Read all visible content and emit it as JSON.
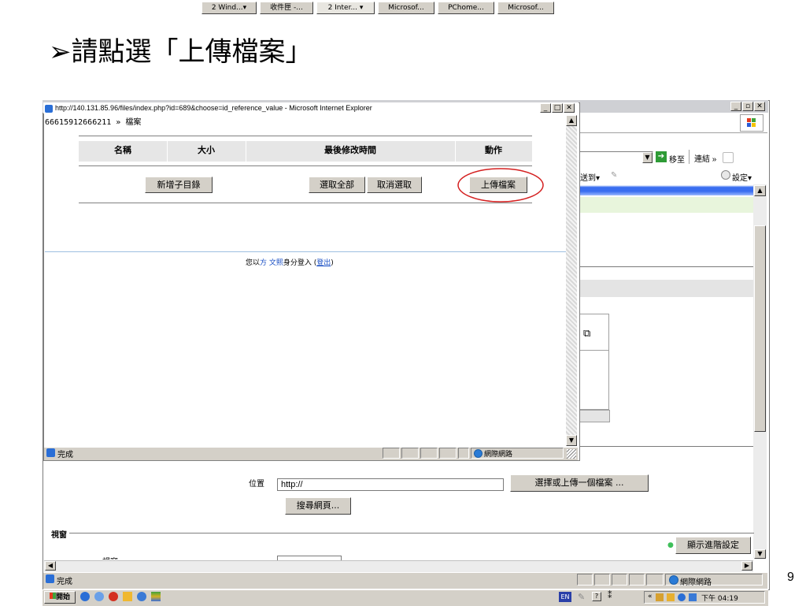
{
  "slide": {
    "title": "➢請點選「上傳檔案」",
    "page_number": "9"
  },
  "back_window": {
    "toolbar": {
      "go_label": "移至",
      "links_label": "連結",
      "links_chevron": "»",
      "send_label": "送到▾",
      "settings_label": "設定▾"
    },
    "form": {
      "location_label": "位置",
      "url_value": "http://",
      "choose_upload_label": "選擇或上傳一個檔案 ...",
      "search_web_label": "搜尋網頁..."
    },
    "section_label": "視窗",
    "advanced_settings_label": "顯示進階設定",
    "partial_label": "視窗",
    "status_text": "完成",
    "zone_text": "網際網路"
  },
  "popup": {
    "title": "http://140.131.85.96/files/index.php?id=689&choose=id_reference_value - Microsoft Internet Explorer",
    "breadcrumb": "66615912666211 » 檔案",
    "columns": [
      "名稱",
      "大小",
      "最後修改時間",
      "動作"
    ],
    "buttons": {
      "new_folder": "新增子目錄",
      "select_all": "選取全部",
      "deselect": "取消選取",
      "upload": "上傳檔案"
    },
    "login_prefix": "您以",
    "login_user": "方 文熙",
    "login_mid": "身分登入 (",
    "logout_label": "登出",
    "login_suffix": ")",
    "status_text": "完成",
    "zone_text": "網際網路"
  },
  "taskbar": {
    "start_label": "開始",
    "tasks": [
      "2 Wind...▾",
      "收件匣 -...",
      "2 Inter... ▾",
      "Microsof...",
      "PChome...",
      "Microsof..."
    ],
    "lang_badge": "EN",
    "tray_prefix": "«",
    "clock": "下午 04:19"
  },
  "colors": {
    "highlight_circle": "#d42020",
    "link": "#1a4fc4",
    "tab_blue": "#3a6ef0"
  }
}
